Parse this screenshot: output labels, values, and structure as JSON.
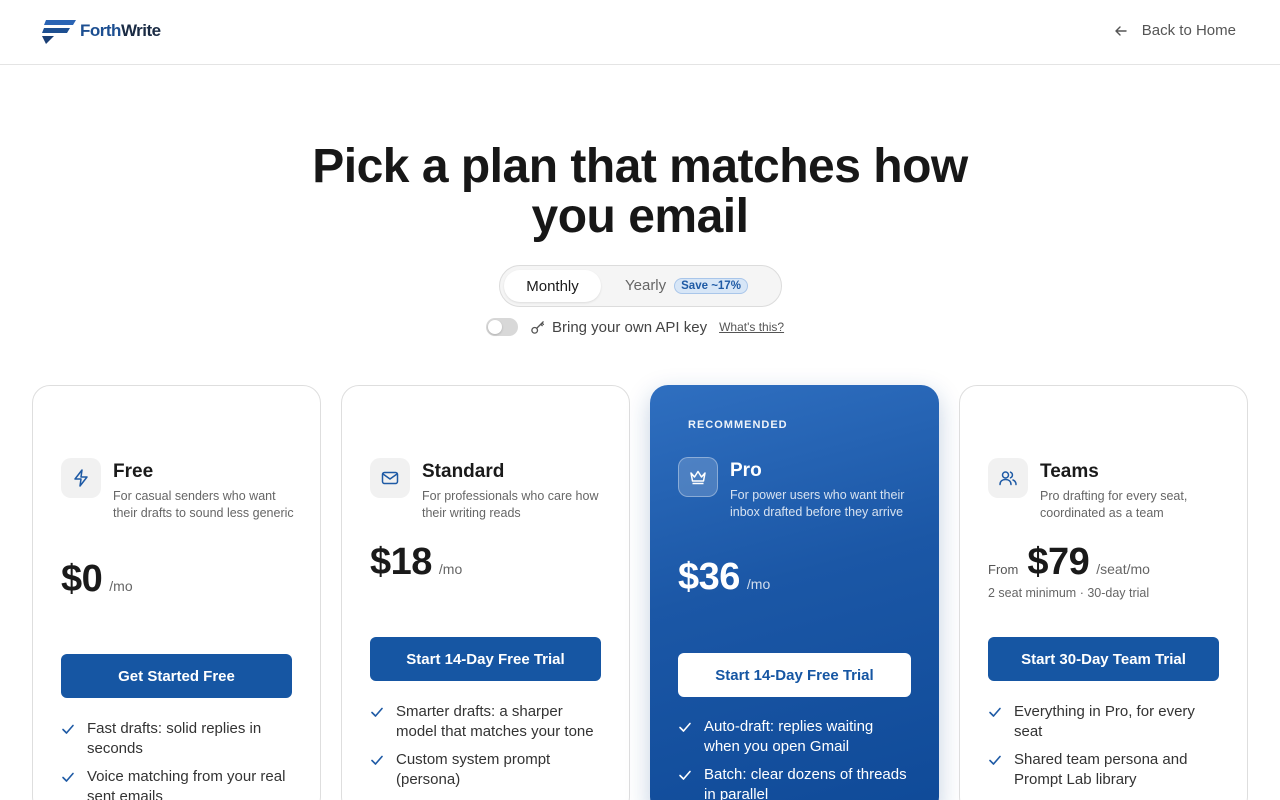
{
  "header": {
    "logo": {
      "part1": "Forth",
      "part2": "Write"
    },
    "back_label": "Back to Home"
  },
  "hero": {
    "title_line1": "Pick a plan that matches how",
    "title_line2": "you email"
  },
  "billing": {
    "monthly": "Monthly",
    "yearly": "Yearly",
    "save_badge": "Save ~17%",
    "selected": "Monthly"
  },
  "byok": {
    "label": "Bring your own API key",
    "help_link": "What's this?",
    "enabled": false
  },
  "plans": [
    {
      "name": "Free",
      "desc": "For casual senders who want their drafts to sound less generic",
      "price": "$0",
      "per": "/mo",
      "cta": "Get Started Free",
      "icon": "bolt-icon",
      "features": [
        "Fast drafts: solid replies in seconds",
        "Voice matching from your real sent emails"
      ]
    },
    {
      "name": "Standard",
      "desc": "For professionals who care how their writing reads",
      "price": "$18",
      "per": "/mo",
      "cta": "Start 14-Day Free Trial",
      "icon": "mail-icon",
      "features": [
        "Smarter drafts: a sharper model that matches your tone",
        "Custom system prompt (persona)"
      ]
    },
    {
      "name": "Pro",
      "badge": "RECOMMENDED",
      "desc": "For power users who want their inbox drafted before they arrive",
      "price": "$36",
      "per": "/mo",
      "cta": "Start 14-Day Free Trial",
      "icon": "crown-icon",
      "features": [
        "Auto-draft: replies waiting when you open Gmail",
        "Batch: clear dozens of threads in parallel"
      ]
    },
    {
      "name": "Teams",
      "desc": "Pro drafting for every seat, coordinated as a team",
      "from": "From",
      "price": "$79",
      "per": "/seat/mo",
      "note": "2 seat minimum · 30-day trial",
      "cta": "Start 30-Day Team Trial",
      "icon": "users-icon",
      "features": [
        "Everything in Pro, for every seat",
        "Shared team persona and Prompt Lab library"
      ]
    }
  ],
  "colors": {
    "accent": "#1656a3",
    "pro_card": "#1b57a6",
    "badge_bg": "#d7e6f7"
  }
}
